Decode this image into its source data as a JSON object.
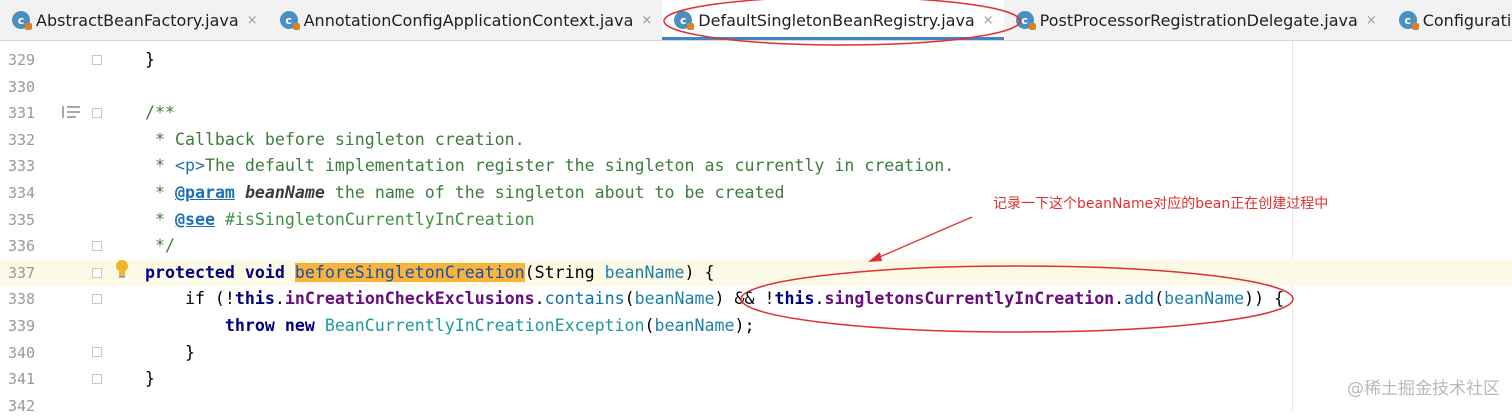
{
  "tabs": [
    {
      "label": "AbstractBeanFactory.java",
      "icon": "class-file-icon",
      "active": false
    },
    {
      "label": "AnnotationConfigApplicationContext.java",
      "icon": "class-file-icon",
      "active": false
    },
    {
      "label": "DefaultSingletonBeanRegistry.java",
      "icon": "class-file-icon",
      "active": true
    },
    {
      "label": "PostProcessorRegistrationDelegate.java",
      "icon": "class-file-icon",
      "active": false
    },
    {
      "label": "Configuratio",
      "icon": "class-file-icon",
      "active": false
    }
  ],
  "close_glyph": "×",
  "lines": [
    {
      "num": "329"
    },
    {
      "num": "330"
    },
    {
      "num": "331"
    },
    {
      "num": "332"
    },
    {
      "num": "333"
    },
    {
      "num": "334"
    },
    {
      "num": "335"
    },
    {
      "num": "336"
    },
    {
      "num": "337"
    },
    {
      "num": "338"
    },
    {
      "num": "339"
    },
    {
      "num": "340"
    },
    {
      "num": "341"
    },
    {
      "num": "342"
    }
  ],
  "code": {
    "l329": "}",
    "l331": "/**",
    "l332": " * Callback before singleton creation.",
    "l333_a": " * ",
    "l333_tag": "<p>",
    "l333_b": "The default implementation register the singleton as currently in creation.",
    "l334_a": " * ",
    "l334_tag": "@param",
    "l334_name": "beanName",
    "l334_b": " the name of the singleton about to be created",
    "l335_a": " * ",
    "l335_tag": "@see",
    "l335_b": " #isSingletonCurrentlyInCreation",
    "l336": " */",
    "l337_kw": "protected void ",
    "l337_fn": "beforeSingletonCreation",
    "l337_a": "(String ",
    "l337_param": "beanName",
    "l337_b": ") {",
    "l338_a": "    if (!",
    "l338_this1": "this",
    "l338_dot1": ".",
    "l338_field1": "inCreationCheckExclusions",
    "l338_dot2": ".",
    "l338_meth1": "contains",
    "l338_paren1": "(",
    "l338_param1": "beanName",
    "l338_b": ") && !",
    "l338_this2": "this",
    "l338_dot3": ".",
    "l338_field2": "singletonsCurrentlyInCreation",
    "l338_dot4": ".",
    "l338_meth2": "add",
    "l338_paren2": "(",
    "l338_param2": "beanName",
    "l338_c": ")) {",
    "l339_kw": "        throw new ",
    "l339_cls": "BeanCurrentlyInCreationException",
    "l339_a": "(",
    "l339_param": "beanName",
    "l339_b": ");",
    "l340": "    }",
    "l341": "}"
  },
  "annotation": {
    "text": "记录一下这个beanName对应的bean正在创建过程中",
    "color": "#e03030"
  },
  "watermark": "@稀土掘金技术社区",
  "colors": {
    "accent": "#4083c9",
    "highlight": "#f6b43c",
    "annotation": "#e03030"
  }
}
